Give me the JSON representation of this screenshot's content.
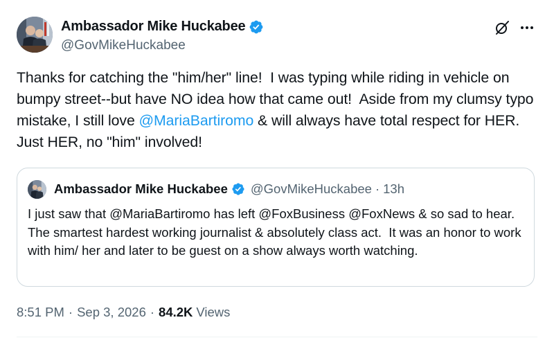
{
  "author": {
    "display_name": "Ambassador Mike Huckabee",
    "handle": "@GovMikeHuckabee",
    "verified": true
  },
  "icons": {
    "verified": "verified-badge-icon",
    "grok": "grok-icon",
    "more": "more-options-icon"
  },
  "tweet": {
    "text_before": "Thanks for catching the \"him/her\" line!  I was typing while riding in vehicle on bumpy street--but have NO idea how that came out!  Aside from my clumsy typo mistake, I still love ",
    "mention": "@MariaBartiromo",
    "text_after": " & will always have total respect for HER.  Just HER, no \"him\" involved!"
  },
  "quoted_tweet": {
    "display_name": "Ambassador Mike Huckabee",
    "handle": "@GovMikeHuckabee",
    "dot": "·",
    "time": "13h",
    "text": "I just saw that @MariaBartiromo has left @FoxBusiness @FoxNews & so sad to hear. The smartest hardest working journalist & absolutely class act.  It was an honor to work with him/ her and later to be guest on a show always worth watching."
  },
  "meta": {
    "time": "8:51 PM",
    "sep1": "·",
    "date": "Sep 3, 2026",
    "sep2": "·",
    "views_count": "84.2K",
    "views_label": "Views"
  },
  "colors": {
    "accent": "#1d9bf0",
    "secondary_text": "#536471",
    "border": "#cfd9de"
  }
}
